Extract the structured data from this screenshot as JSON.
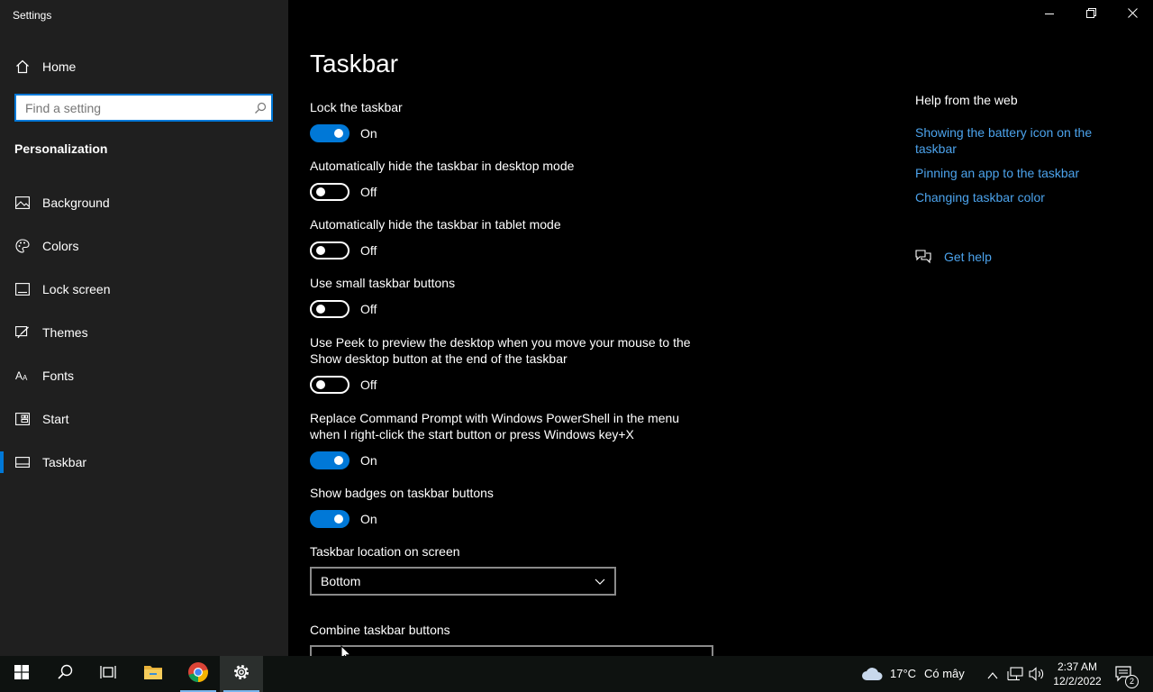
{
  "window": {
    "title": "Settings",
    "controls": [
      "minimize-icon",
      "restore-icon",
      "close-icon"
    ]
  },
  "sidebar": {
    "home_label": "Home",
    "search_placeholder": "Find a setting",
    "section_title": "Personalization",
    "items": [
      {
        "label": "Background",
        "icon": "picture-icon"
      },
      {
        "label": "Colors",
        "icon": "palette-icon"
      },
      {
        "label": "Lock screen",
        "icon": "lock-screen-icon"
      },
      {
        "label": "Themes",
        "icon": "brush-icon"
      },
      {
        "label": "Fonts",
        "icon": "font-icon"
      },
      {
        "label": "Start",
        "icon": "start-icon"
      },
      {
        "label": "Taskbar",
        "icon": "taskbar-icon",
        "active": true
      }
    ]
  },
  "main": {
    "title": "Taskbar",
    "settings": [
      {
        "label": "Lock the taskbar",
        "state": "On"
      },
      {
        "label": "Automatically hide the taskbar in desktop mode",
        "state": "Off"
      },
      {
        "label": "Automatically hide the taskbar in tablet mode",
        "state": "Off"
      },
      {
        "label": "Use small taskbar buttons",
        "state": "Off"
      },
      {
        "label": "Use Peek to preview the desktop when you move your mouse to the Show desktop button at the end of the taskbar",
        "state": "Off"
      },
      {
        "label": "Replace Command Prompt with Windows PowerShell in the menu when I right-click the start button or press Windows key+X",
        "state": "On"
      },
      {
        "label": "Show badges on taskbar buttons",
        "state": "On"
      }
    ],
    "location_label": "Taskbar location on screen",
    "location_value": "Bottom",
    "combine_label": "Combine taskbar buttons"
  },
  "help": {
    "title": "Help from the web",
    "links": [
      "Showing the battery icon on the taskbar",
      "Pinning an app to the taskbar",
      "Changing taskbar color"
    ],
    "get_help": "Get help"
  },
  "taskbar": {
    "weather_temp": "17°C",
    "weather_desc": "Có mây",
    "time": "2:37 AM",
    "date": "12/2/2022",
    "notification_count": "2",
    "colors": {
      "accent": "#0078d7",
      "link": "#4ca3ec"
    }
  }
}
